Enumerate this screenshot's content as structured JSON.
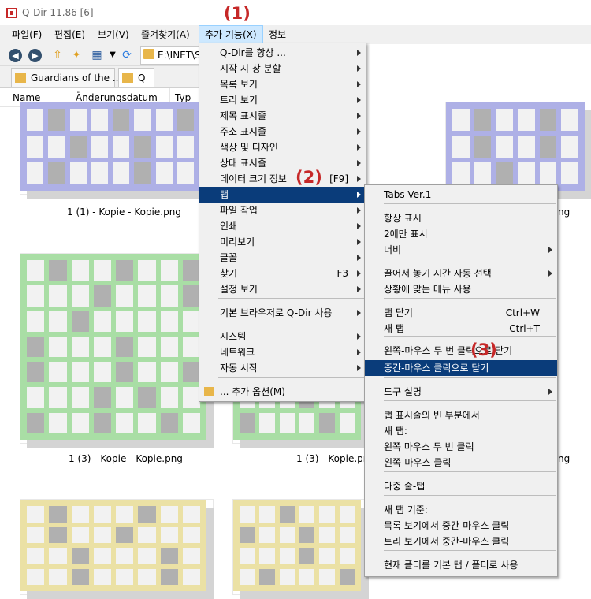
{
  "window": {
    "title": "Q-Dir 11.86 [6]"
  },
  "menubar": {
    "items": [
      {
        "label": "파일(F)"
      },
      {
        "label": "편집(E)"
      },
      {
        "label": "보기(V)"
      },
      {
        "label": "즐겨찾기(A)"
      },
      {
        "label": "추가 기능(X)"
      },
      {
        "label": "정보"
      }
    ]
  },
  "address": {
    "path": "E:\\INET\\Sc"
  },
  "tabs": [
    {
      "label": "Guardians of the ..."
    },
    {
      "label": "Q"
    }
  ],
  "columns": [
    {
      "label": "Name"
    },
    {
      "label": "Änderungsdatum"
    },
    {
      "label": "Typ"
    }
  ],
  "files": [
    {
      "name": "1 (1) - Kopie - Kopie.png"
    },
    {
      "name": "1 (3) - Kopie - Kopie.png"
    },
    {
      "name": "1 (3) - Kopie.png"
    },
    {
      "name": "ng"
    },
    {
      "name": "ng"
    }
  ],
  "thumb_colors": {
    "purple": "#aeb0e6",
    "green": "#a9dea5",
    "yellow": "#ebe1a5"
  },
  "main_menu": {
    "items": [
      {
        "label": "Q-Dir를 항상 ...",
        "shortcut": "",
        "submenu": true
      },
      {
        "label": "시작 시 창 분할",
        "shortcut": "",
        "submenu": true
      },
      {
        "label": "목록 보기",
        "shortcut": "",
        "submenu": true
      },
      {
        "label": "트리 보기",
        "shortcut": "",
        "submenu": true
      },
      {
        "label": "제목 표시줄",
        "shortcut": "",
        "submenu": true
      },
      {
        "label": "주소 표시줄",
        "shortcut": "",
        "submenu": true
      },
      {
        "label": "색상 및 디자인",
        "shortcut": "",
        "submenu": true
      },
      {
        "label": "상태 표시줄",
        "shortcut": "",
        "submenu": true
      },
      {
        "label": "데이터 크기 정보",
        "shortcut": "[F9]",
        "submenu": true
      },
      {
        "label": "탭",
        "shortcut": "",
        "submenu": true,
        "highlighted": true
      },
      {
        "label": "파일 작업",
        "shortcut": "",
        "submenu": true
      },
      {
        "label": "인쇄",
        "shortcut": "",
        "submenu": true
      },
      {
        "label": "미리보기",
        "shortcut": "",
        "submenu": true
      },
      {
        "label": "글꼴",
        "shortcut": "",
        "submenu": true
      },
      {
        "label": "찾기",
        "shortcut": "F3",
        "submenu": true
      },
      {
        "label": "설정 보기",
        "shortcut": "",
        "submenu": true
      },
      {
        "label": "기본 브라우저로 Q-Dir 사용",
        "shortcut": "",
        "submenu": true
      },
      {
        "label": "시스템",
        "shortcut": "",
        "submenu": true
      },
      {
        "label": "네트워크",
        "shortcut": "",
        "submenu": true
      },
      {
        "label": "자동 시작",
        "shortcut": "",
        "submenu": true
      },
      {
        "label": "... 추가 옵션(M)",
        "shortcut": "",
        "submenu": false
      }
    ]
  },
  "tabs_submenu": {
    "items": [
      {
        "label": "Tabs Ver.1",
        "shortcut": "",
        "submenu": false
      },
      {
        "label": "항상 표시",
        "shortcut": "",
        "submenu": false
      },
      {
        "label": "2에만 표시",
        "shortcut": "",
        "submenu": false
      },
      {
        "label": "너비",
        "shortcut": "",
        "submenu": true
      },
      {
        "label": "끌어서 놓기 시간 자동 선택",
        "shortcut": "",
        "submenu": true
      },
      {
        "label": "상황에 맞는 메뉴 사용",
        "shortcut": "",
        "submenu": false
      },
      {
        "label": "탭 닫기",
        "shortcut": "Ctrl+W",
        "submenu": false
      },
      {
        "label": "새 탭",
        "shortcut": "Ctrl+T",
        "submenu": false
      },
      {
        "label": "왼쪽-마우스 두 번 클릭으로 닫기",
        "shortcut": "",
        "submenu": false
      },
      {
        "label": "중간-마우스 클릭으로 닫기",
        "shortcut": "",
        "submenu": false,
        "highlighted": true
      },
      {
        "label": "도구 설명",
        "shortcut": "",
        "submenu": true
      },
      {
        "label": "탭 표시줄의 빈 부분에서",
        "shortcut": "",
        "submenu": false
      },
      {
        "label": "새 탭:",
        "shortcut": "",
        "submenu": false
      },
      {
        "label": "왼쪽 마우스 두 번 클릭",
        "shortcut": "",
        "submenu": false
      },
      {
        "label": "왼쪽-마우스 클릭",
        "shortcut": "",
        "submenu": false
      },
      {
        "label": "다중 줄-탭",
        "shortcut": "",
        "submenu": false
      },
      {
        "label": "새 탭 기준:",
        "shortcut": "",
        "submenu": false
      },
      {
        "label": "목록 보기에서 중간-마우스 클릭",
        "shortcut": "",
        "submenu": false
      },
      {
        "label": "트리 보기에서 중간-마우스 클릭",
        "shortcut": "",
        "submenu": false
      },
      {
        "label": "현재 폴더를 기본 탭 / 폴더로 사용",
        "shortcut": "",
        "submenu": false
      }
    ]
  },
  "annotations": [
    {
      "label": "(1)"
    },
    {
      "label": "(2)"
    },
    {
      "label": "(3)"
    }
  ]
}
